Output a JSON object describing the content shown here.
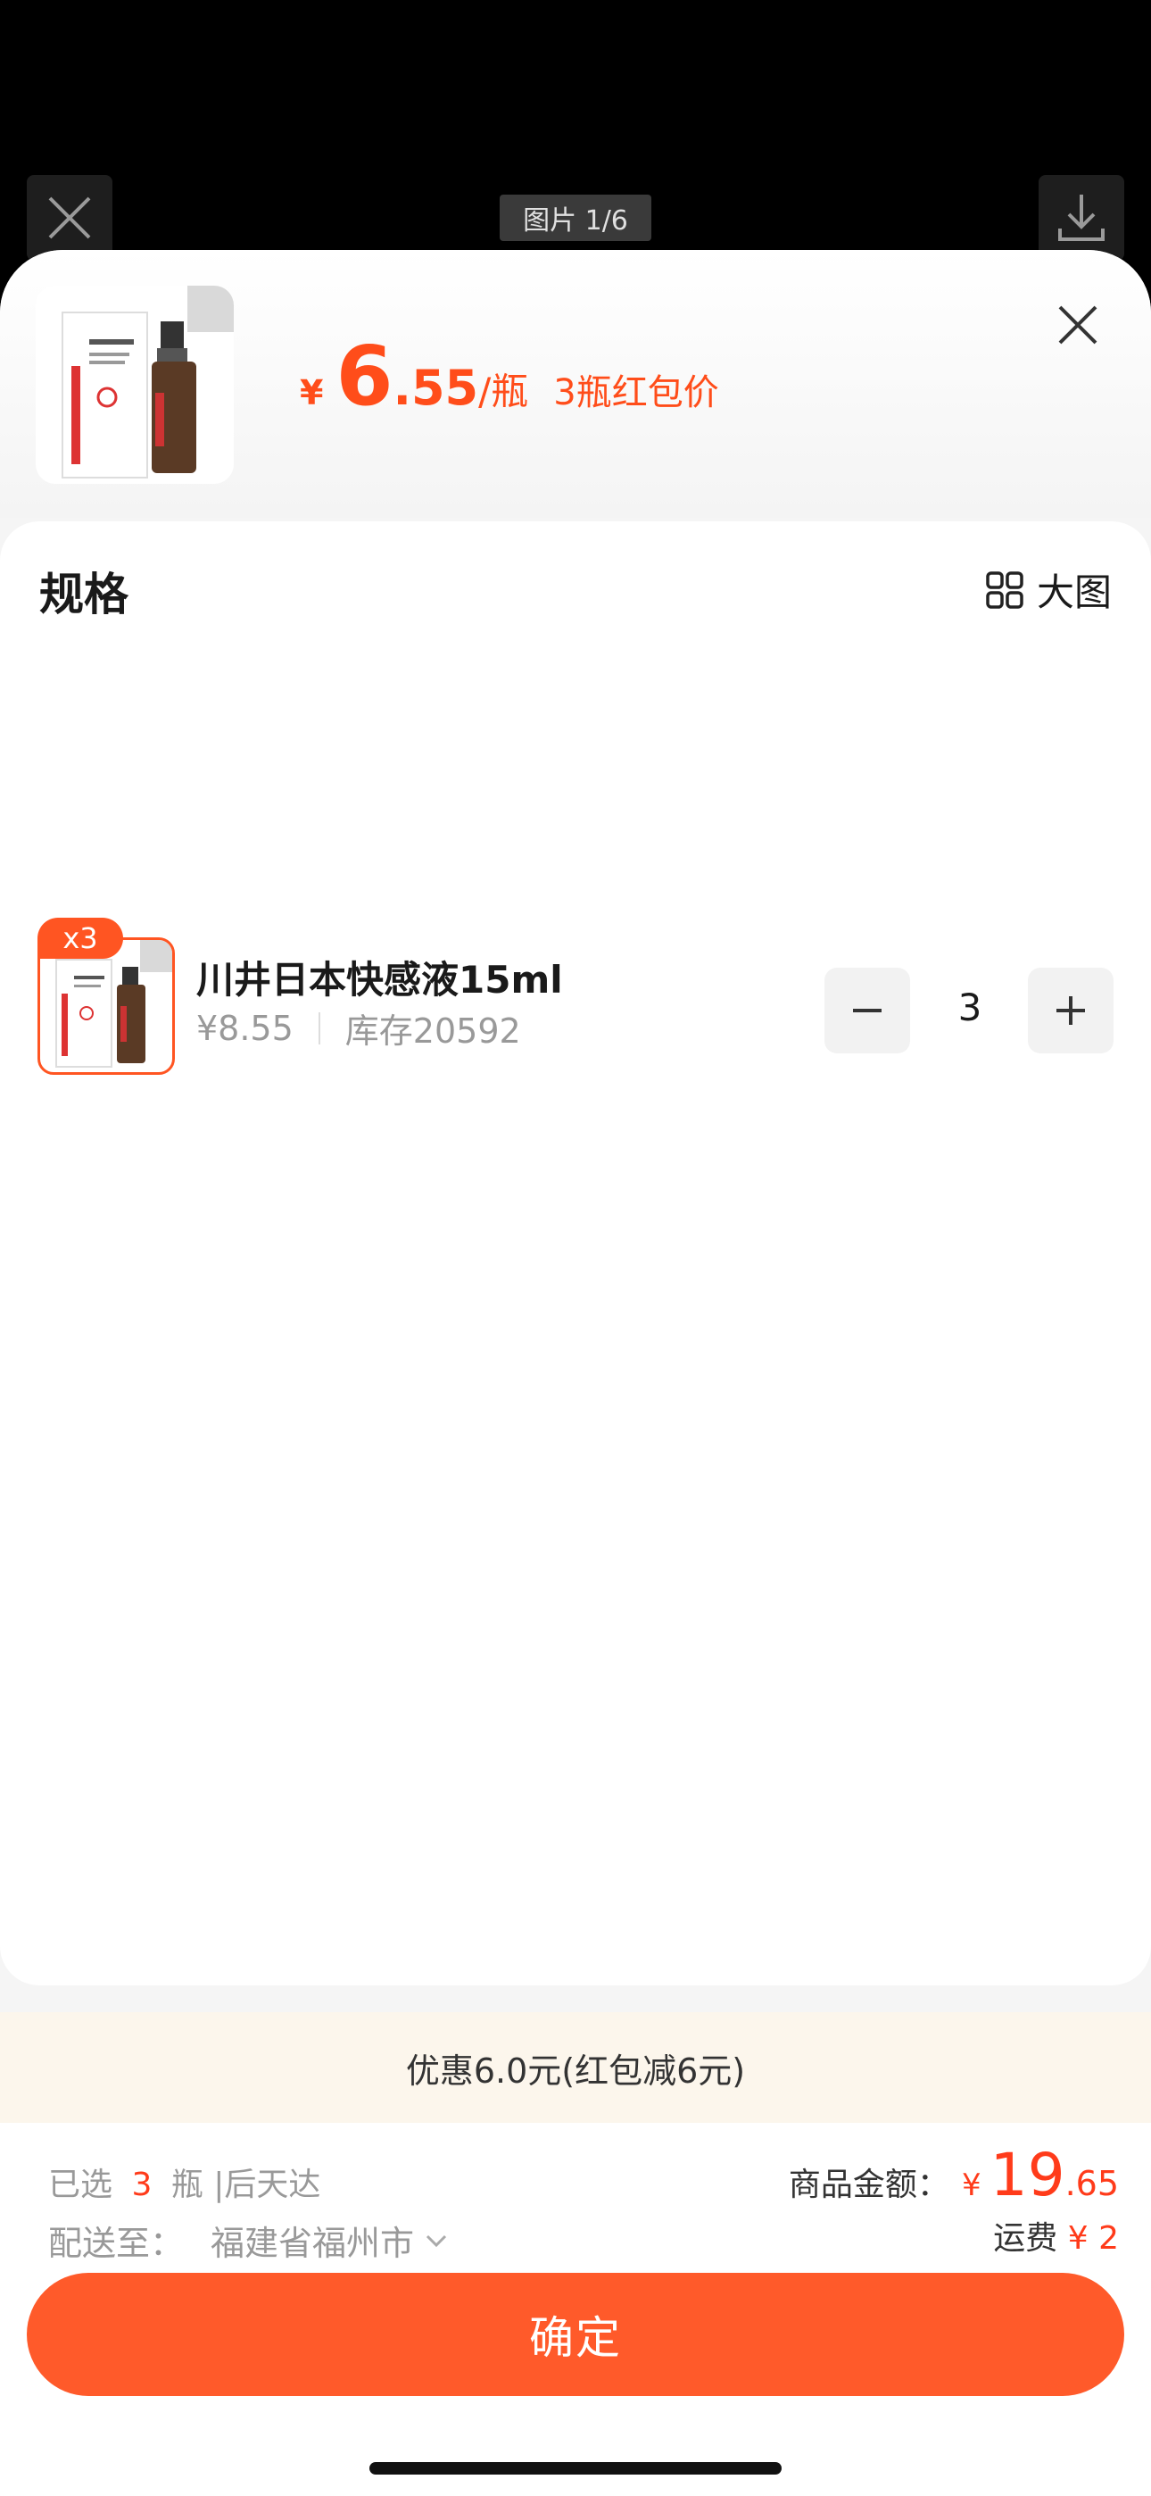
{
  "viewer": {
    "counter": "图片 1/6",
    "icons": [
      "close-icon",
      "download-icon"
    ]
  },
  "header": {
    "currency": "¥",
    "price_int": "6",
    "price_dec": ".55",
    "unit": "/瓶",
    "promo_label": "3瓶红包价"
  },
  "spec": {
    "title": "规格",
    "big_view_label": "大图",
    "item": {
      "badge": "x3",
      "name": "川井日本快感液15ml",
      "price": "¥8.55",
      "stock": "库存20592",
      "quantity": "3"
    }
  },
  "discount": {
    "text": "优惠6.0元(红包减6元)"
  },
  "footer": {
    "selected_prefix": "已选",
    "selected_count": "3",
    "selected_suffix": "瓶 |后天达",
    "ship_label": "配送至：",
    "ship_city": "福建省福州市",
    "amount_label": "商品金额：",
    "amount_currency": "¥",
    "amount_int": "19",
    "amount_dec": ".65",
    "fee_label": "运费",
    "fee_value": "¥ 2",
    "confirm_label": "确定"
  },
  "colors": {
    "accent": "#ff4d1a",
    "button": "#ff5a2a",
    "discount_bg": "#fcf6ec"
  }
}
